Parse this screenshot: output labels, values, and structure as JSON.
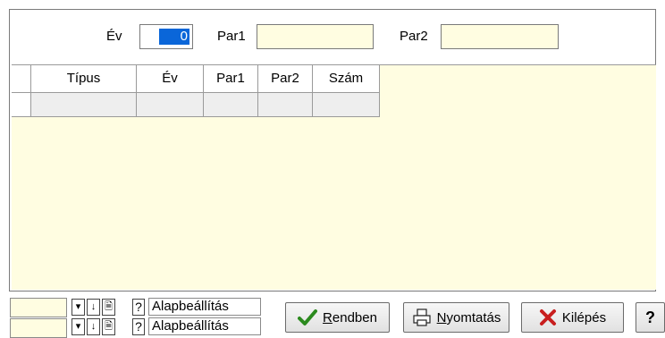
{
  "filters": {
    "ev_label": "Év",
    "ev_value": "0",
    "par1_label": "Par1",
    "par1_value": "",
    "par2_label": "Par2",
    "par2_value": ""
  },
  "grid": {
    "columns": [
      "Típus",
      "Év",
      "Par1",
      "Par2",
      "Szám"
    ],
    "rows": [
      [
        "",
        "",
        "",
        "",
        ""
      ]
    ]
  },
  "settings": [
    {
      "value": "",
      "label": "Alapbeállítás"
    },
    {
      "value": "",
      "label": "Alapbeállítás"
    }
  ],
  "buttons": {
    "ok_first": "R",
    "ok_rest": "endben",
    "print_first": "N",
    "print_rest": "yomtatás",
    "exit": "Kilépés",
    "help": "?"
  },
  "colors": {
    "field_bg": "#fffde1",
    "selection": "#0a66d9",
    "ok_icon": "#2b8a1e",
    "exit_icon": "#c81e1e"
  }
}
